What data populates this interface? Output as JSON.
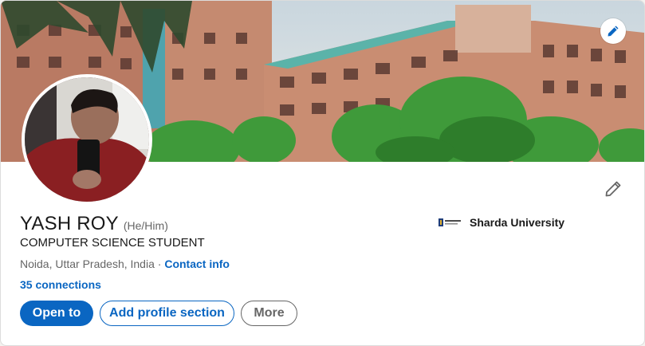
{
  "profile": {
    "name": "YASH ROY",
    "pronouns": "(He/Him)",
    "headline": "COMPUTER SCIENCE STUDENT",
    "location": "Noida, Uttar Pradesh, India",
    "separator": " · ",
    "contact_info_label": "Contact info",
    "connections_label": "35 connections"
  },
  "education": {
    "name": "Sharda University",
    "logo_icon": "sharda-university-logo"
  },
  "actions": {
    "open_to_label": "Open to",
    "add_section_label": "Add profile section",
    "more_label": "More"
  },
  "icons": {
    "banner_edit": "pencil-icon",
    "intro_edit": "pencil-icon"
  },
  "colors": {
    "brand_blue": "#0a66c2",
    "text_primary": "#191919",
    "text_secondary": "#666666"
  }
}
